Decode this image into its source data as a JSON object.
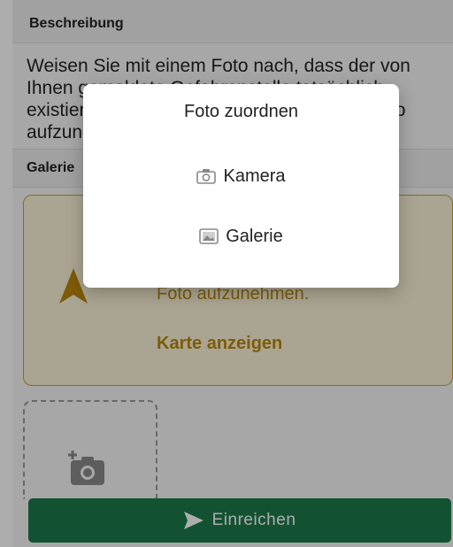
{
  "form": {
    "description_header": "Beschreibung",
    "description_text": "Weisen Sie mit einem Foto nach, dass der von Ihnen gemeldete Gefahrenstelle tatsächlich existiert. Gehen Sie zu der Stelle, um ein Foto aufzunehmen.",
    "gallery_header": "Galerie",
    "info_text": "Foto aufzunehmen.",
    "info_link": "Karte anzeigen",
    "submit_label": "Einreichen"
  },
  "dialog": {
    "title": "Foto zuordnen",
    "options": [
      {
        "label": "Kamera",
        "icon": "camera-icon"
      },
      {
        "label": "Galerie",
        "icon": "gallery-icon"
      }
    ]
  },
  "colors": {
    "accent_green": "#1b7a4a",
    "info_gold": "#b8860b",
    "info_border": "#c9a227",
    "info_bg": "#fbf3d8"
  }
}
